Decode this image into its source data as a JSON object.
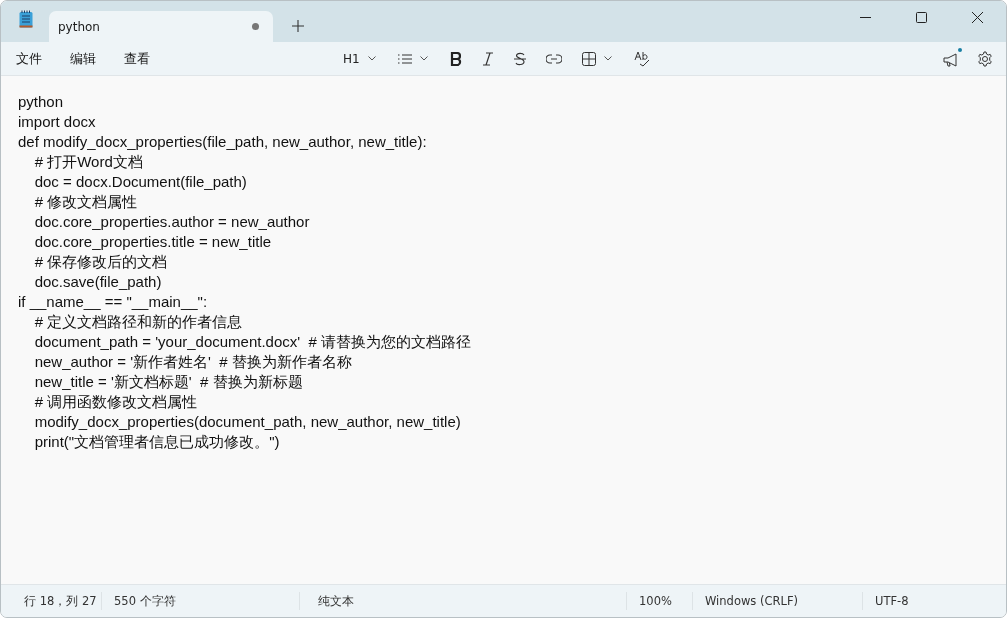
{
  "tabs": [
    {
      "label": "python",
      "selected": true,
      "unsaved": true
    }
  ],
  "menu": [
    "文件",
    "编辑",
    "查看"
  ],
  "format_toolbar": {
    "heading": "H1"
  },
  "editor": {
    "lines": [
      "python",
      "import docx",
      "def modify_docx_properties(file_path, new_author, new_title):",
      "    # 打开Word文档",
      "    doc = docx.Document(file_path)",
      "    # 修改文档属性",
      "    doc.core_properties.author = new_author",
      "    doc.core_properties.title = new_title",
      "    # 保存修改后的文档",
      "    doc.save(file_path)",
      "if __name__ == \"__main__\":",
      "    # 定义文档路径和新的作者信息",
      "    document_path = 'your_document.docx'  # 请替换为您的文档路径",
      "    new_author = '新作者姓名'  # 替换为新作者名称",
      "    new_title = '新文档标题'  # 替换为新标题",
      "    # 调用函数修改文档属性",
      "    modify_docx_properties(document_path, new_author, new_title)",
      "    print(\"文档管理者信息已成功修改。\")"
    ]
  },
  "status_bar": {
    "position": "行 18，列 27",
    "char_count": "550 个字符",
    "format": "纯文本",
    "zoom": "100%",
    "line_ending": "Windows (CRLF)",
    "encoding": "UTF-8"
  },
  "notifications": {
    "has_new": true
  }
}
